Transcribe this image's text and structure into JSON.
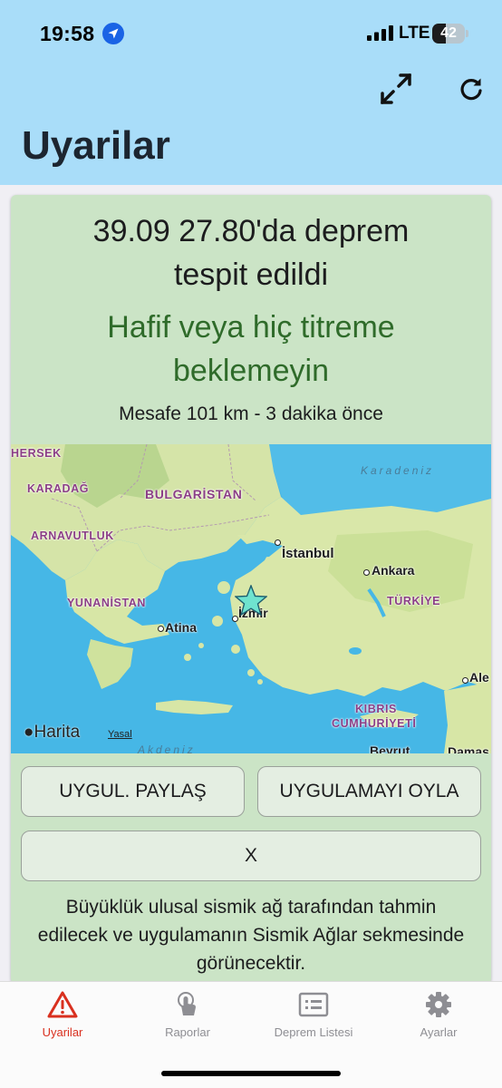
{
  "status_bar": {
    "time": "19:58",
    "network": "LTE",
    "battery": "42",
    "battery_level": 0.42
  },
  "header": {
    "title": "Uyarilar",
    "expand_icon": "expand-arrows-icon",
    "refresh_icon": "refresh-icon"
  },
  "alert": {
    "headline": "39.09 27.80'da deprem tespit edildi",
    "shaking": "Hafif veya hiç titreme beklemeyin",
    "distance": "Mesafe 101 km - 3 dakika önce",
    "epicenter_marker": "star-icon"
  },
  "map": {
    "countries": [
      "HERSEK",
      "KARADAĞ",
      "BULGARİSTAN",
      "ARNAVUTLUK",
      "YUNANİSTAN",
      "TÜRKİYE",
      "KIBRIS",
      "CUMHURİYETİ"
    ],
    "cities": [
      "İstanbul",
      "Ankara",
      "Atina",
      "İzmir",
      "Ale",
      "Beyrut",
      "Damas"
    ],
    "seas": [
      "Karadeniz",
      "Akdeniz"
    ],
    "attribution": "Harita",
    "legal": "Yasal"
  },
  "buttons": {
    "share": "UYGUL. PAYLAŞ",
    "rate": "UYGULAMAYI OYLA",
    "close": "X"
  },
  "info_text": "Büyüklük ulusal sismik ağ tarafından tahmin edilecek ve uygulamanın Sismik Ağlar sekmesinde görünecektir.",
  "tabs": [
    {
      "label": "Uyarilar",
      "icon": "warning-triangle-icon",
      "active": true
    },
    {
      "label": "Raporlar",
      "icon": "hand-tap-icon",
      "active": false
    },
    {
      "label": "Deprem Listesi",
      "icon": "list-card-icon",
      "active": false
    },
    {
      "label": "Ayarlar",
      "icon": "gear-icon",
      "active": false
    }
  ],
  "colors": {
    "header_bg": "#a9ddf9",
    "card_bg": "#cbe4c6",
    "shaking_text": "#2f6b2a",
    "active_tab": "#d9301f",
    "inactive_tab": "#8e8e93"
  }
}
